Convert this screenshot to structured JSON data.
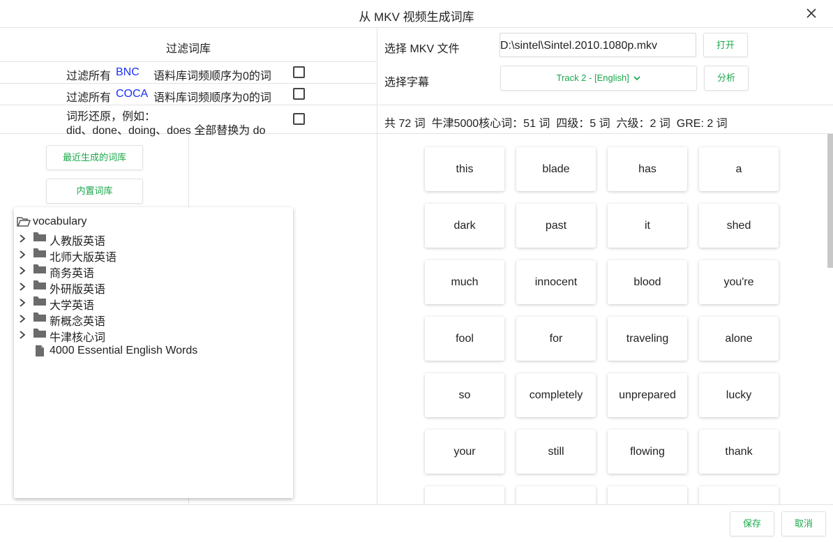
{
  "window": {
    "title": "从 MKV 视频生成词库"
  },
  "filter": {
    "header": "过滤词库",
    "bnc": {
      "prefix": "过滤所有",
      "corpus": "BNC",
      "suffix": "语料库词频顺序为0的词",
      "checked": false
    },
    "coca": {
      "prefix": "过滤所有",
      "corpus": "COCA",
      "suffix": "语料库词频顺序为0的词",
      "checked": false
    },
    "lemma": {
      "line1": "词形还原，例如：",
      "line2": "did、done、doing、does 全部替换为 do",
      "checked": false
    }
  },
  "sidebar": {
    "recent_button": "最近生成的词库",
    "builtin_button": "内置词库"
  },
  "tree": {
    "root": "vocabulary",
    "folders": [
      "人教版英语",
      "北师大版英语",
      "商务英语",
      "外研版英语",
      "大学英语",
      "新概念英语",
      "牛津核心词"
    ],
    "files": [
      "4000 Essential English Words"
    ]
  },
  "source": {
    "file_label": "选择 MKV 文件",
    "file_value": "D:\\sintel\\Sintel.2010.1080p.mkv",
    "open_button": "打开",
    "subtitle_label": "选择字幕",
    "subtitle_value": "Track 2 - [English]",
    "analyze_button": "分析"
  },
  "stats": "共 72 词  牛津5000核心词：51 词  四级：5 词  六级：2 词  GRE: 2 词",
  "words": [
    "this",
    "blade",
    "has",
    "a",
    "dark",
    "past",
    "it",
    "shed",
    "much",
    "innocent",
    "blood",
    "you're",
    "fool",
    "for",
    "traveling",
    "alone",
    "so",
    "completely",
    "unprepared",
    "lucky",
    "your",
    "still",
    "flowing",
    "thank",
    "",
    "",
    "",
    ""
  ],
  "footer": {
    "save_button": "保存",
    "cancel_button": "取消"
  },
  "colors": {
    "accent": "#1aa84a",
    "corpus_link": "#1a2ff5"
  }
}
